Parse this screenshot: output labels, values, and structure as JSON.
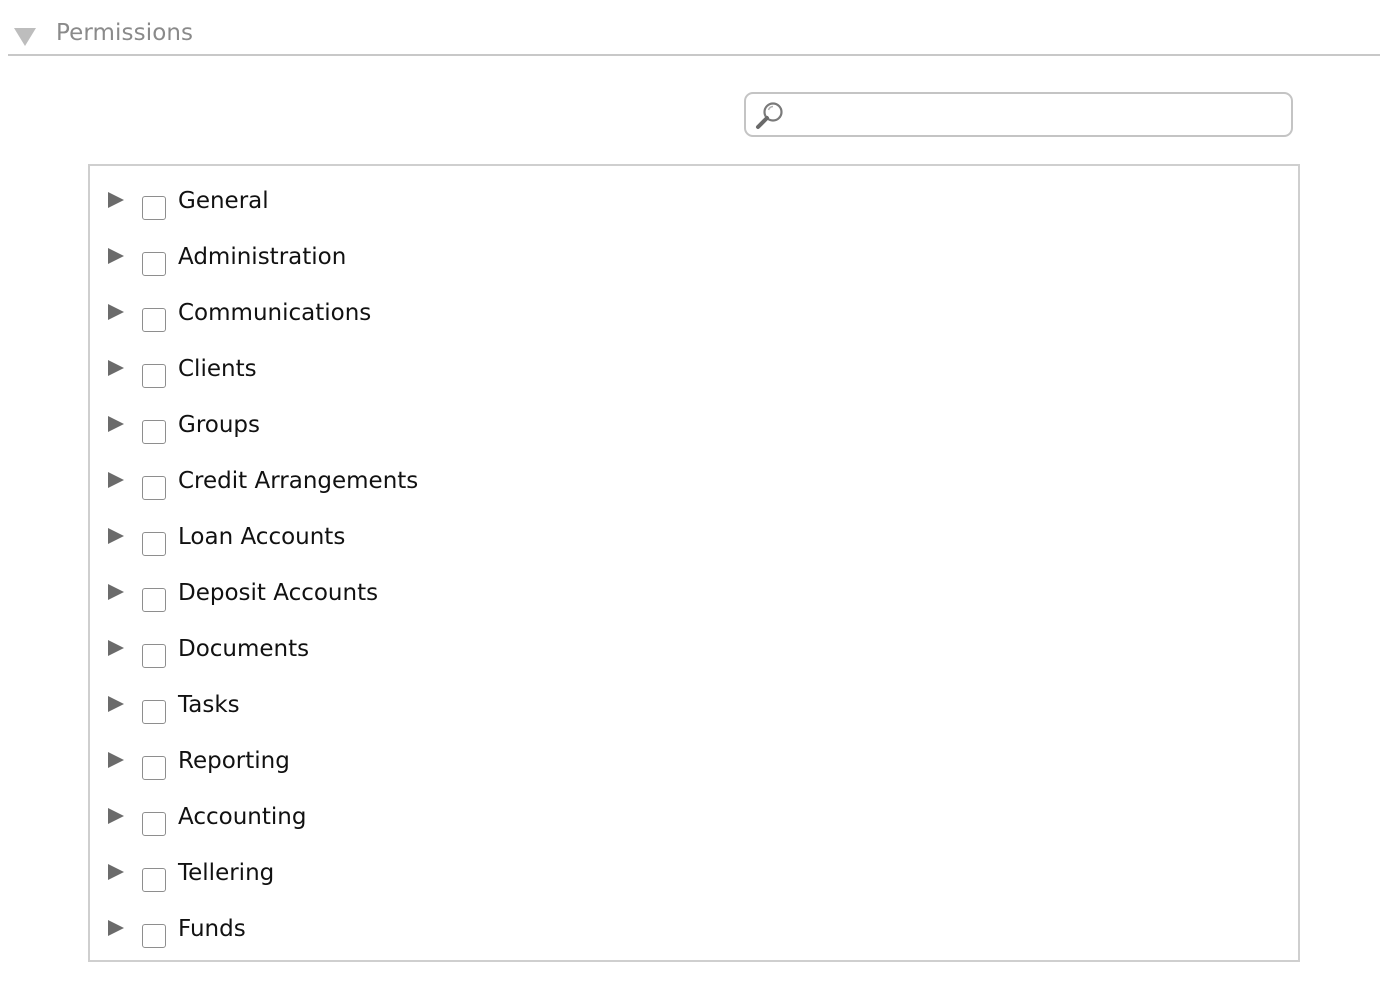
{
  "section": {
    "title": "Permissions",
    "toggle_icon": "triangle-down-icon",
    "toggle_color": "#b5b5b5"
  },
  "search": {
    "placeholder": "",
    "value": "",
    "icon": "magnifier-icon"
  },
  "tree": {
    "arrow_color": "#6b6b6b",
    "items": [
      {
        "label": "General",
        "checked": false
      },
      {
        "label": "Administration",
        "checked": false
      },
      {
        "label": "Communications",
        "checked": false
      },
      {
        "label": "Clients",
        "checked": false
      },
      {
        "label": "Groups",
        "checked": false
      },
      {
        "label": "Credit Arrangements",
        "checked": false
      },
      {
        "label": "Loan Accounts",
        "checked": false
      },
      {
        "label": "Deposit Accounts",
        "checked": false
      },
      {
        "label": "Documents",
        "checked": false
      },
      {
        "label": "Tasks",
        "checked": false
      },
      {
        "label": "Reporting",
        "checked": false
      },
      {
        "label": "Accounting",
        "checked": false
      },
      {
        "label": "Tellering",
        "checked": false
      },
      {
        "label": "Funds",
        "checked": false
      }
    ]
  }
}
